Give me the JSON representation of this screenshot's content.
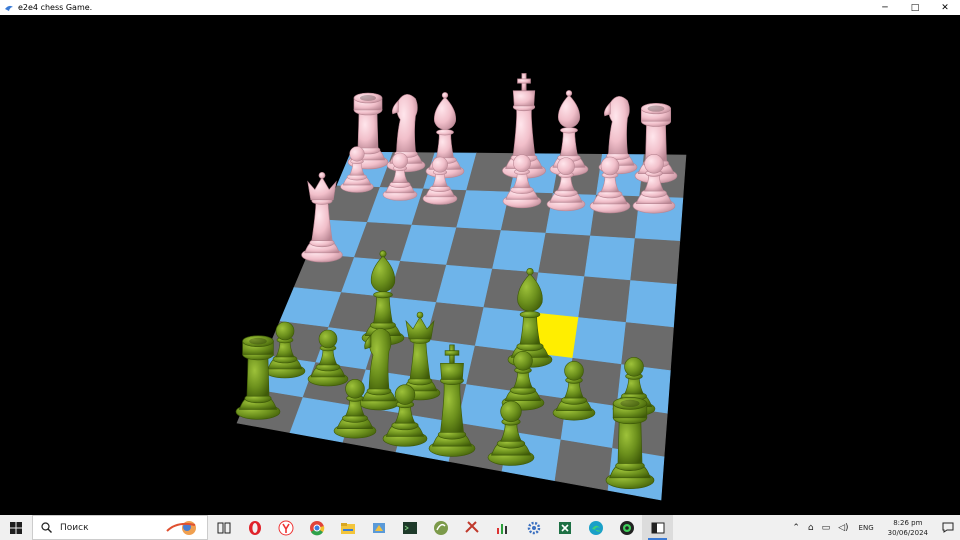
{
  "window": {
    "title": "e2e4 chess Game.",
    "controls": {
      "minimize": "─",
      "maximize": "□",
      "close": "✕"
    }
  },
  "board": {
    "colors": {
      "light": "#6eb4ea",
      "dark": "#6b6b6b",
      "highlight": "#ffee00",
      "white_pieces": "#6b8f1c",
      "black_pieces": "#f3c2cc"
    },
    "highlighted_square": "selected",
    "pieces": [
      {
        "name": "black-rook-left",
        "type": "rook",
        "side": "black"
      },
      {
        "name": "black-knight-left",
        "type": "knight",
        "side": "black"
      },
      {
        "name": "black-bishop-left",
        "type": "bishop",
        "side": "black"
      },
      {
        "name": "black-king",
        "type": "king",
        "side": "black"
      },
      {
        "name": "black-bishop-right",
        "type": "bishop",
        "side": "black"
      },
      {
        "name": "black-knight-right",
        "type": "knight",
        "side": "black"
      },
      {
        "name": "black-rook-right",
        "type": "rook",
        "side": "black"
      },
      {
        "name": "black-queen",
        "type": "queen",
        "side": "black"
      },
      {
        "name": "black-pawn-1",
        "type": "pawn",
        "side": "black"
      },
      {
        "name": "black-pawn-2",
        "type": "pawn",
        "side": "black"
      },
      {
        "name": "black-pawn-3",
        "type": "pawn",
        "side": "black"
      },
      {
        "name": "black-pawn-4",
        "type": "pawn",
        "side": "black"
      },
      {
        "name": "black-pawn-5",
        "type": "pawn",
        "side": "black"
      },
      {
        "name": "black-pawn-6",
        "type": "pawn",
        "side": "black"
      },
      {
        "name": "black-pawn-7",
        "type": "pawn",
        "side": "black"
      },
      {
        "name": "white-bishop-left",
        "type": "bishop",
        "side": "white"
      },
      {
        "name": "white-bishop-right",
        "type": "bishop",
        "side": "white"
      },
      {
        "name": "white-rook-left",
        "type": "rook",
        "side": "white"
      },
      {
        "name": "white-rook-right",
        "type": "rook",
        "side": "white"
      },
      {
        "name": "white-knight",
        "type": "knight",
        "side": "white"
      },
      {
        "name": "white-queen",
        "type": "queen",
        "side": "white"
      },
      {
        "name": "white-king",
        "type": "king",
        "side": "white"
      },
      {
        "name": "white-pawn-1",
        "type": "pawn",
        "side": "white"
      },
      {
        "name": "white-pawn-2",
        "type": "pawn",
        "side": "white"
      },
      {
        "name": "white-pawn-3",
        "type": "pawn",
        "side": "white"
      },
      {
        "name": "white-pawn-4",
        "type": "pawn",
        "side": "white"
      },
      {
        "name": "white-pawn-5",
        "type": "pawn",
        "side": "white"
      },
      {
        "name": "white-pawn-6",
        "type": "pawn",
        "side": "white"
      },
      {
        "name": "white-pawn-7",
        "type": "pawn",
        "side": "white"
      },
      {
        "name": "white-pawn-8",
        "type": "pawn",
        "side": "white"
      }
    ]
  },
  "taskbar": {
    "search_placeholder": "Поиск",
    "apps": [
      "task-view",
      "opera",
      "yandex",
      "chrome",
      "file-explorer",
      "app-paint",
      "terminal",
      "app-ink",
      "app-tools",
      "app-stats",
      "app-settings",
      "excel",
      "edge",
      "app-camera",
      "chess-game"
    ],
    "active_app": "chess-game",
    "tray": {
      "language": "ENG",
      "time": "8:26 pm",
      "date": "30/06/2024"
    }
  }
}
